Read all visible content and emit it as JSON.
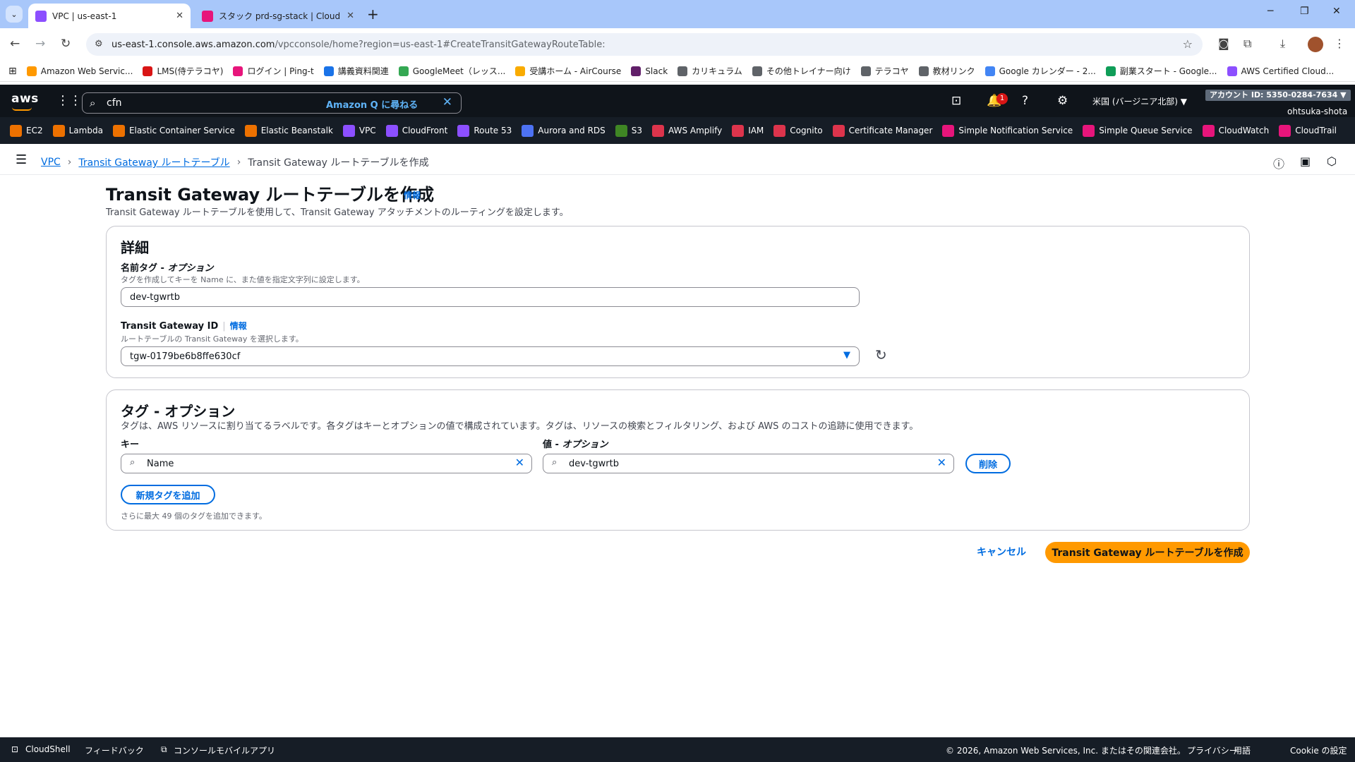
{
  "browser": {
    "tabs": [
      {
        "label": "VPC | us-east-1",
        "active": true,
        "favicon_color": "#8c4fff"
      },
      {
        "label": "スタック prd-sg-stack | CloudFormation",
        "active": false,
        "favicon_color": "#e7157b"
      }
    ],
    "new_tab": "+",
    "url_host": "us-east-1.console.aws.amazon.com",
    "url_path": "/vpcconsole/home?region=us-east-1#CreateTransitGatewayRouteTable:",
    "bookmarks": [
      {
        "label": "Amazon Web Servic...",
        "color": "#ff9900"
      },
      {
        "label": "LMS(侍テラコヤ)",
        "color": "#d91515"
      },
      {
        "label": "ログイン | Ping-t",
        "color": "#e7157b"
      },
      {
        "label": "講義資料関連",
        "color": "#1a73e8"
      },
      {
        "label": "GoogleMeet（レッス...",
        "color": "#34a853"
      },
      {
        "label": "受講ホーム - AirCourse",
        "color": "#f9ab00"
      },
      {
        "label": "Slack",
        "color": "#611f69"
      },
      {
        "label": "カリキュラム",
        "color": "#5f6368"
      },
      {
        "label": "その他トレイナー向け",
        "color": "#5f6368"
      },
      {
        "label": "テラコヤ",
        "color": "#5f6368"
      },
      {
        "label": "教材リンク",
        "color": "#5f6368"
      },
      {
        "label": "Google カレンダー - 2...",
        "color": "#4285f4"
      },
      {
        "label": "副業スタート - Google...",
        "color": "#0f9d58"
      },
      {
        "label": "AWS Certified Cloud...",
        "color": "#8c4fff"
      }
    ]
  },
  "aws_header": {
    "logo": "aws",
    "search_value": "cfn",
    "amazon_q": "Amazon Q に尋ねる",
    "notification_count": "1",
    "region": "米国 (バージニア北部) ▼",
    "account_id": "アカウント ID: 5350-0284-7634 ▼",
    "username": "ohtsuka-shota"
  },
  "services": [
    {
      "label": "EC2",
      "color": "#ed7100"
    },
    {
      "label": "Lambda",
      "color": "#ed7100"
    },
    {
      "label": "Elastic Container Service",
      "color": "#ed7100"
    },
    {
      "label": "Elastic Beanstalk",
      "color": "#ed7100"
    },
    {
      "label": "VPC",
      "color": "#8c4fff"
    },
    {
      "label": "CloudFront",
      "color": "#8c4fff"
    },
    {
      "label": "Route 53",
      "color": "#8c4fff"
    },
    {
      "label": "Aurora and RDS",
      "color": "#4d72f3"
    },
    {
      "label": "S3",
      "color": "#3f8624"
    },
    {
      "label": "AWS Amplify",
      "color": "#dd344c"
    },
    {
      "label": "IAM",
      "color": "#dd344c"
    },
    {
      "label": "Cognito",
      "color": "#dd344c"
    },
    {
      "label": "Certificate Manager",
      "color": "#dd344c"
    },
    {
      "label": "Simple Notification Service",
      "color": "#e7157b"
    },
    {
      "label": "Simple Queue Service",
      "color": "#e7157b"
    },
    {
      "label": "CloudWatch",
      "color": "#e7157b"
    },
    {
      "label": "CloudTrail",
      "color": "#e7157b"
    }
  ],
  "breadcrumbs": {
    "vpc": "VPC",
    "tgw_rt": "Transit Gateway ルートテーブル",
    "current": "Transit Gateway ルートテーブルを作成"
  },
  "page": {
    "title": "Transit Gateway ルートテーブルを作成",
    "info": "情報",
    "description": "Transit Gateway ルートテーブルを使用して、Transit Gateway アタッチメントのルーティングを設定します。"
  },
  "details": {
    "title": "詳細",
    "name_tag_label": "名前タグ - ",
    "name_tag_label_optional": "オプション",
    "name_tag_desc": "タグを作成してキーを Name に、また値を指定文字列に設定します。",
    "name_tag_value": "dev-tgwrtb",
    "tgw_id_label": "Transit Gateway ID",
    "tgw_id_info": "情報",
    "tgw_id_desc": "ルートテーブルの Transit Gateway を選択します。",
    "tgw_id_value": "tgw-0179be6b8ffe630cf"
  },
  "tags": {
    "title": "タグ - オプション",
    "description": "タグは、AWS リソースに割り当てるラベルです。各タグはキーとオプションの値で構成されています。タグは、リソースの検索とフィルタリング、および AWS のコストの追跡に使用できます。",
    "key_label": "キー",
    "value_label": "値 - ",
    "value_label_optional": "オプション",
    "key_value": "Name",
    "value_value": "dev-tgwrtb",
    "remove": "削除",
    "add_tag": "新規タグを追加",
    "hint": "さらに最大 49 個のタグを追加できます。"
  },
  "actions": {
    "cancel": "キャンセル",
    "create": "Transit Gateway ルートテーブルを作成"
  },
  "footer": {
    "cloudshell": "CloudShell",
    "feedback": "フィードバック",
    "mobile_app": "コンソールモバイルアプリ",
    "copyright": "© 2026, Amazon Web Services, Inc. またはその関連会社。",
    "privacy": "プライバシー",
    "terms": "用語",
    "cookies": "Cookie の設定"
  }
}
